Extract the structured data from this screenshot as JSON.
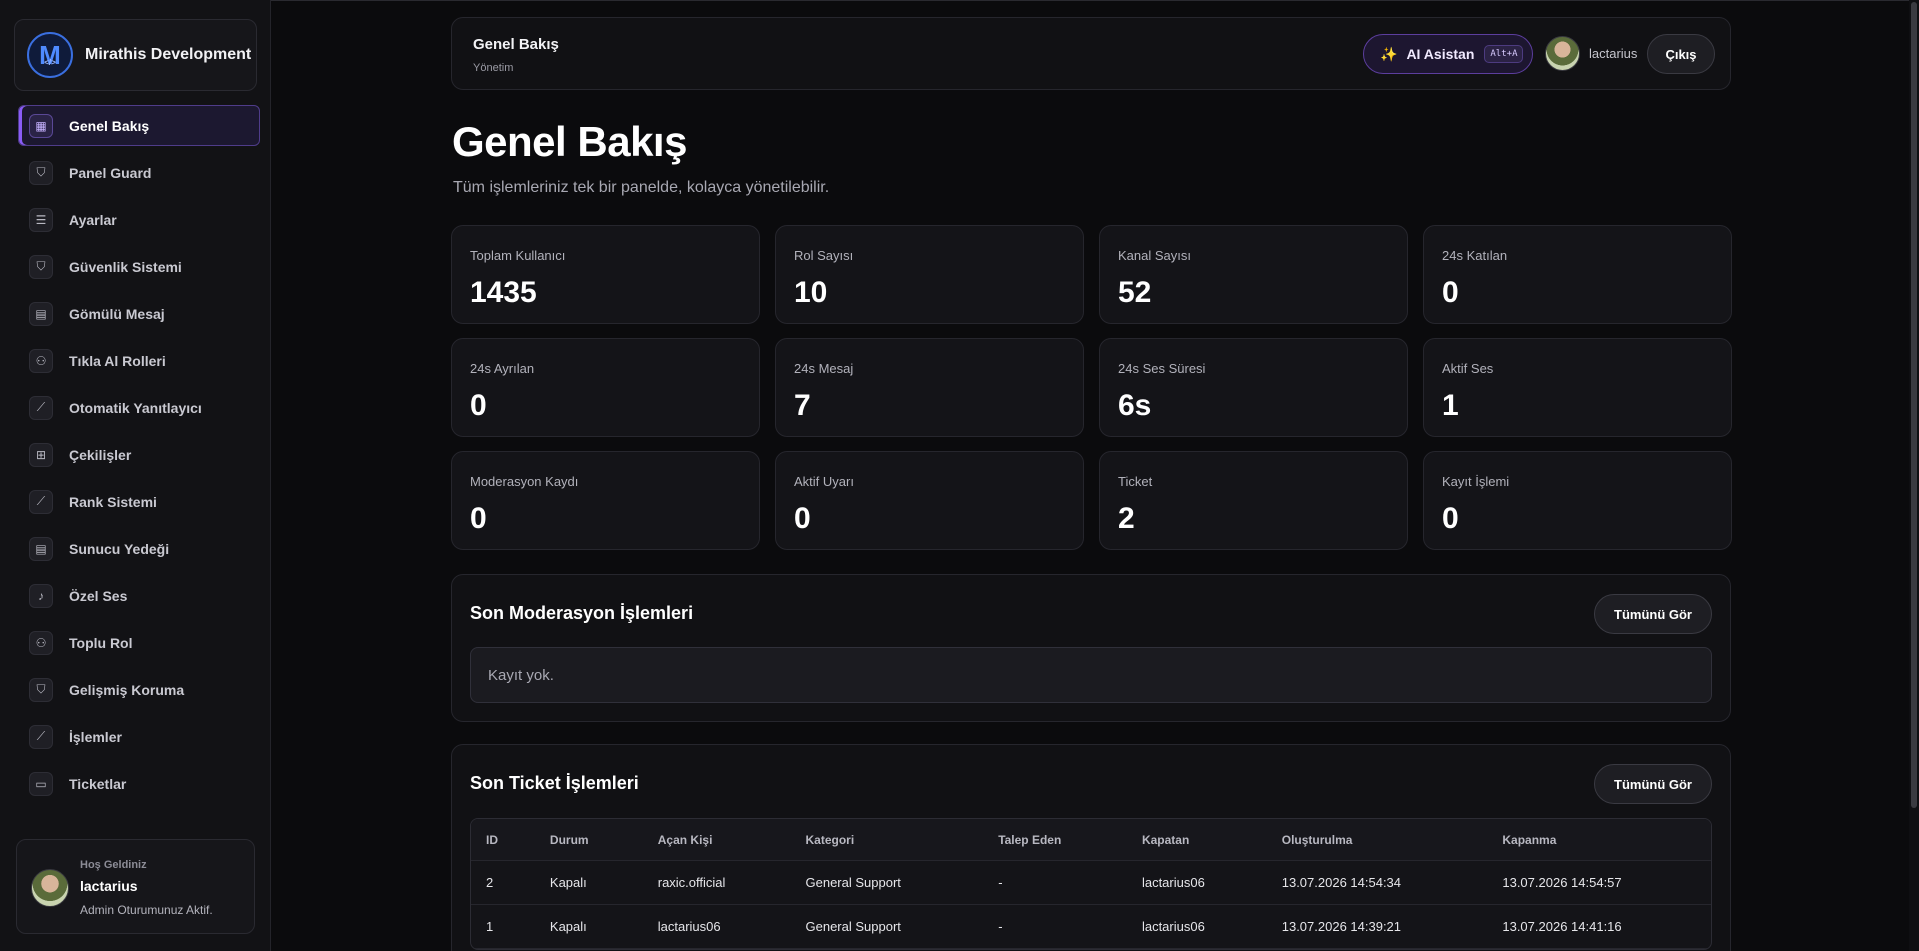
{
  "brand": {
    "name": "Mirathis Development",
    "logo_letter": "M",
    "logo_sub": "</>"
  },
  "sidebar": {
    "items": [
      {
        "label": "Genel Bakış",
        "icon": "grid-icon",
        "glyph": "▦",
        "active": true
      },
      {
        "label": "Panel Guard",
        "icon": "shield-icon",
        "glyph": "⛉"
      },
      {
        "label": "Ayarlar",
        "icon": "sliders-icon",
        "glyph": "☰"
      },
      {
        "label": "Güvenlik Sistemi",
        "icon": "shield-check-icon",
        "glyph": "⛉"
      },
      {
        "label": "Gömülü Mesaj",
        "icon": "document-icon",
        "glyph": "▤"
      },
      {
        "label": "Tıkla Al Rolleri",
        "icon": "user-plus-icon",
        "glyph": "⚇"
      },
      {
        "label": "Otomatik Yanıtlayıcı",
        "icon": "chart-line-icon",
        "glyph": "⟋"
      },
      {
        "label": "Çekilişler",
        "icon": "gift-icon",
        "glyph": "⊞"
      },
      {
        "label": "Rank Sistemi",
        "icon": "chart-line-icon",
        "glyph": "⟋"
      },
      {
        "label": "Sunucu Yedeği",
        "icon": "document-icon",
        "glyph": "▤"
      },
      {
        "label": "Özel Ses",
        "icon": "microphone-icon",
        "glyph": "♪"
      },
      {
        "label": "Toplu Rol",
        "icon": "user-plus-icon",
        "glyph": "⚇"
      },
      {
        "label": "Gelişmiş Koruma",
        "icon": "shield-check-icon",
        "glyph": "⛉"
      },
      {
        "label": "İşlemler",
        "icon": "chart-line-icon",
        "glyph": "⟋"
      },
      {
        "label": "Ticketlar",
        "icon": "ticket-icon",
        "glyph": "▭"
      }
    ]
  },
  "welcome": {
    "greeting": "Hoş Geldiniz",
    "name": "lactarius",
    "status": "Admin Oturumunuz Aktif."
  },
  "header": {
    "title": "Genel Bakış",
    "subtitle": "Yönetim",
    "ai_label": "AI Asistan",
    "ai_shortcut": "Alt+A",
    "ai_icon": "sparkle-icon",
    "username": "lactarius",
    "logout_label": "Çıkış"
  },
  "main": {
    "title": "Genel Bakış",
    "description": "Tüm işlemleriniz tek bir panelde, kolayca yönetilebilir."
  },
  "stats": [
    {
      "label": "Toplam Kullanıcı",
      "value": "1435"
    },
    {
      "label": "Rol Sayısı",
      "value": "10"
    },
    {
      "label": "Kanal Sayısı",
      "value": "52"
    },
    {
      "label": "24s Katılan",
      "value": "0"
    },
    {
      "label": "24s Ayrılan",
      "value": "0"
    },
    {
      "label": "24s Mesaj",
      "value": "7"
    },
    {
      "label": "24s Ses Süresi",
      "value": "6s"
    },
    {
      "label": "Aktif Ses",
      "value": "1"
    },
    {
      "label": "Moderasyon Kaydı",
      "value": "0"
    },
    {
      "label": "Aktif Uyarı",
      "value": "0"
    },
    {
      "label": "Ticket",
      "value": "2"
    },
    {
      "label": "Kayıt İşlemi",
      "value": "0"
    }
  ],
  "moderation": {
    "title": "Son Moderasyon İşlemleri",
    "see_all_label": "Tümünü Gör",
    "empty_text": "Kayıt yok."
  },
  "tickets": {
    "title": "Son Ticket İşlemleri",
    "see_all_label": "Tümünü Gör",
    "columns": [
      "ID",
      "Durum",
      "Açan Kişi",
      "Kategori",
      "Talep Eden",
      "Kapatan",
      "Oluşturulma",
      "Kapanma"
    ],
    "rows": [
      [
        "2",
        "Kapalı",
        "raxic.official",
        "General Support",
        "-",
        "lactarius06",
        "13.07.2026 14:54:34",
        "13.07.2026 14:54:57"
      ],
      [
        "1",
        "Kapalı",
        "lactarius06",
        "General Support",
        "-",
        "lactarius06",
        "13.07.2026 14:39:21",
        "13.07.2026 14:41:16"
      ]
    ]
  },
  "colors": {
    "accent": "#8a5cf6",
    "background": "#0b0b0d",
    "card": "#141418"
  }
}
